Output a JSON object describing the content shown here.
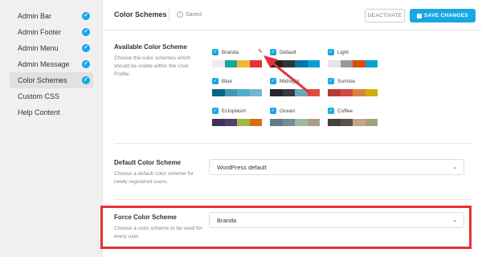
{
  "sidebar": {
    "items": [
      {
        "label": "Admin Bar",
        "checked": true
      },
      {
        "label": "Admin Footer",
        "checked": true
      },
      {
        "label": "Admin Menu",
        "checked": true
      },
      {
        "label": "Admin Message",
        "checked": true
      },
      {
        "label": "Color Schemes",
        "checked": true,
        "active": true
      },
      {
        "label": "Custom CSS",
        "checked": false
      },
      {
        "label": "Help Content",
        "checked": false
      }
    ]
  },
  "header": {
    "title": "Color Schemes",
    "saved_text": "Saved",
    "deactivate_label": "DEACTIVATE",
    "save_label": "SAVE CHANGES"
  },
  "available": {
    "label": "Available Color Scheme",
    "description": "Choose the color schemes which should be visible within the User Profile.",
    "schemes": [
      {
        "name": "Branda",
        "colors": [
          "#ececec",
          "#19a69a",
          "#f2b632",
          "#e8303a"
        ]
      },
      {
        "name": "Default",
        "colors": [
          "#222222",
          "#333333",
          "#0073aa",
          "#00a0d2"
        ]
      },
      {
        "name": "Light",
        "colors": [
          "#e5e5e5",
          "#999999",
          "#d64e07",
          "#04a4cc"
        ]
      },
      {
        "name": "Blue",
        "colors": [
          "#096484",
          "#4796b3",
          "#52accc",
          "#74b6ce"
        ]
      },
      {
        "name": "Midnight",
        "colors": [
          "#25282b",
          "#363b3f",
          "#69a8bb",
          "#e14d43"
        ]
      },
      {
        "name": "Sunrise",
        "colors": [
          "#b43c38",
          "#cf4944",
          "#dd823b",
          "#ccaf0b"
        ]
      },
      {
        "name": "Ectoplasm",
        "colors": [
          "#413256",
          "#523f6d",
          "#a3b745",
          "#d46f15"
        ]
      },
      {
        "name": "Ocean",
        "colors": [
          "#627c83",
          "#738e96",
          "#9ebaa0",
          "#aa9d88"
        ]
      },
      {
        "name": "Coffee",
        "colors": [
          "#46403c",
          "#59524c",
          "#c7a589",
          "#9ea476"
        ]
      }
    ]
  },
  "default_scheme": {
    "label": "Default Color Scheme",
    "description": "Choose a default color scheme for newly registered users.",
    "value": "WordPress default"
  },
  "force_scheme": {
    "label": "Force Color Scheme",
    "description": "Choose a color scheme to be used for every user.",
    "value": "Branda"
  },
  "colors": {
    "accent": "#17a8e3",
    "annotation_red": "#e8303a"
  }
}
